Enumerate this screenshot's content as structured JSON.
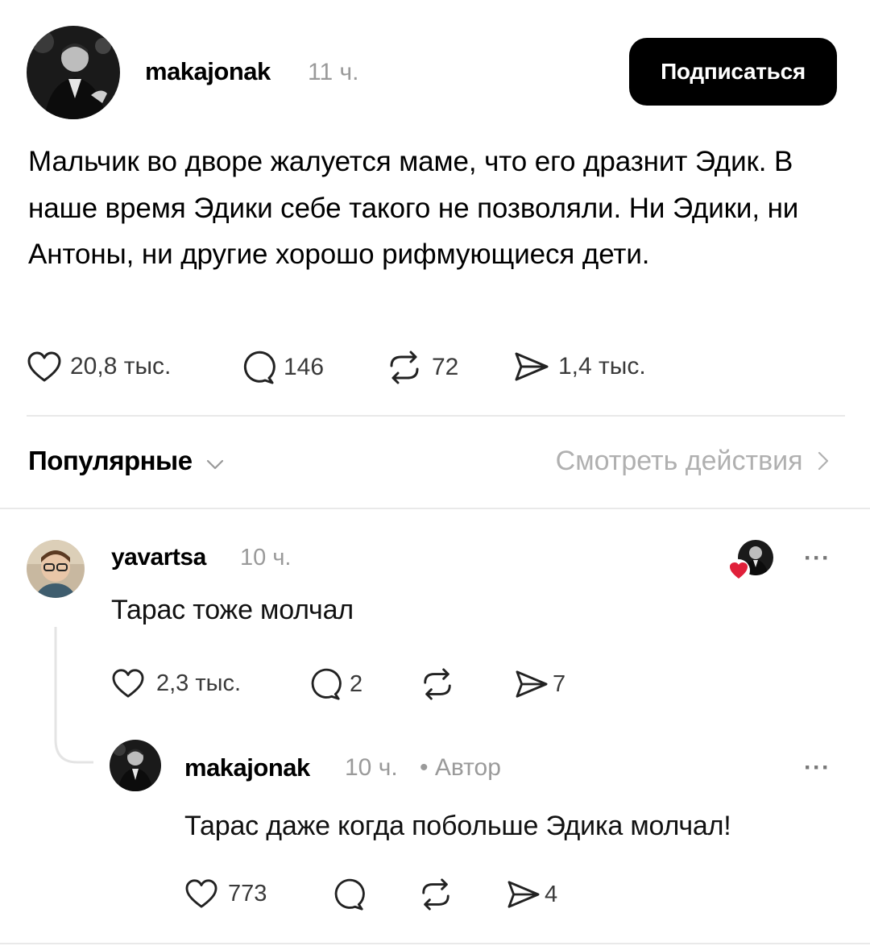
{
  "post": {
    "username": "makajonak",
    "time": "11 ч.",
    "follow_label": "Подписаться",
    "text": "Мальчик во дворе жалуется маме, что его дразнит Эдик. В наше время Эдики себе такого не позволяли. Ни Эдики, ни Антоны, ни другие хорошо рифмующиеся дети.",
    "likes": "20,8 тыс.",
    "comments": "146",
    "reposts": "72",
    "shares": "1,4 тыс."
  },
  "sort": {
    "label": "Популярные",
    "view_activity": "Смотреть действия"
  },
  "comments": [
    {
      "username": "yavartsa",
      "time": "10 ч.",
      "text": "Тарас тоже молчал",
      "likes": "2,3 тыс.",
      "comments": "2",
      "reposts": "",
      "shares": "7",
      "more": "···"
    }
  ],
  "reply": {
    "username": "makajonak",
    "time": "10 ч.",
    "author_badge": "• Автор",
    "text": "Тарас даже когда побольше Эдика молчал!",
    "likes": "773",
    "comments": "",
    "reposts": "",
    "shares": "4",
    "more": "···"
  },
  "icons": {
    "like": "heart-outline-icon",
    "comment": "speech-bubble-icon",
    "repost": "repost-arrows-icon",
    "share": "paper-plane-icon",
    "liked_by_author": "red-heart-icon"
  },
  "colors": {
    "follow_bg": "#000000",
    "muted": "#9a9a9a",
    "liked_heart": "#e0203a"
  }
}
